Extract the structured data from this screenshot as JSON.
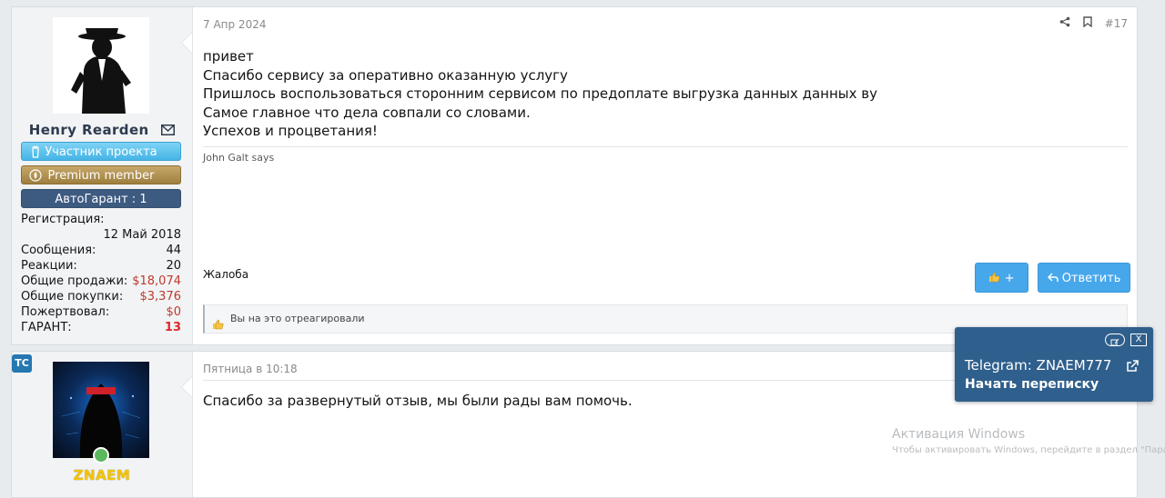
{
  "post1": {
    "user": {
      "name": "Henry Rearden",
      "banners": [
        "Участник проекта",
        "Premium member",
        "АвтоГарант : 1"
      ],
      "registration_label": "Регистрация:",
      "registration_date": "12 Май 2018",
      "stats": [
        {
          "label": "Сообщения:",
          "value": "44",
          "style": "plain"
        },
        {
          "label": "Реакции:",
          "value": "20",
          "style": "plain"
        },
        {
          "label": "Общие продажи:",
          "value": "$18,074",
          "style": "red"
        },
        {
          "label": "Общие покупки:",
          "value": "$3,376",
          "style": "red"
        },
        {
          "label": "Пожертвовал:",
          "value": "$0",
          "style": "red"
        },
        {
          "label": "ГАРАНТ:",
          "value": "13",
          "style": "bold"
        }
      ]
    },
    "date": "7 Апр 2024",
    "post_number": "#17",
    "message_lines": [
      "привет",
      "Спасибо сервису за оперативно оказанную услугу",
      "Пришлось воспользоваться сторонним сервисом по предоплате выгрузка данных данных ву",
      "Самое главное что дела совпали со словами.",
      "Успехов и процветания!"
    ],
    "signature": "John Galt says",
    "report_label": "Жалоба",
    "like_button_label": "+",
    "reply_button_label": "Ответить",
    "reactions_text": "Вы на это отреагировали"
  },
  "post2": {
    "badge": "TC",
    "user": {
      "name": "ZNAEM"
    },
    "date": "Пятница в 10:18",
    "message": "Спасибо за развернутый отзыв, мы были рады вам помочь."
  },
  "telegram_widget": {
    "title": "Telegram: ZNAEM777",
    "subtitle": "Начать переписку",
    "close_label": "X"
  },
  "windows_activation": {
    "title": "Активация Windows",
    "subtitle": "Чтобы активировать Windows, перейдите в раздел \"Пара"
  },
  "colors": {
    "accent": "#47a7eb",
    "money": "#c0392b",
    "guarantee": "#e0262b",
    "telegram_bg": "#2f5f8c",
    "znaem_name": "#f5c400"
  }
}
